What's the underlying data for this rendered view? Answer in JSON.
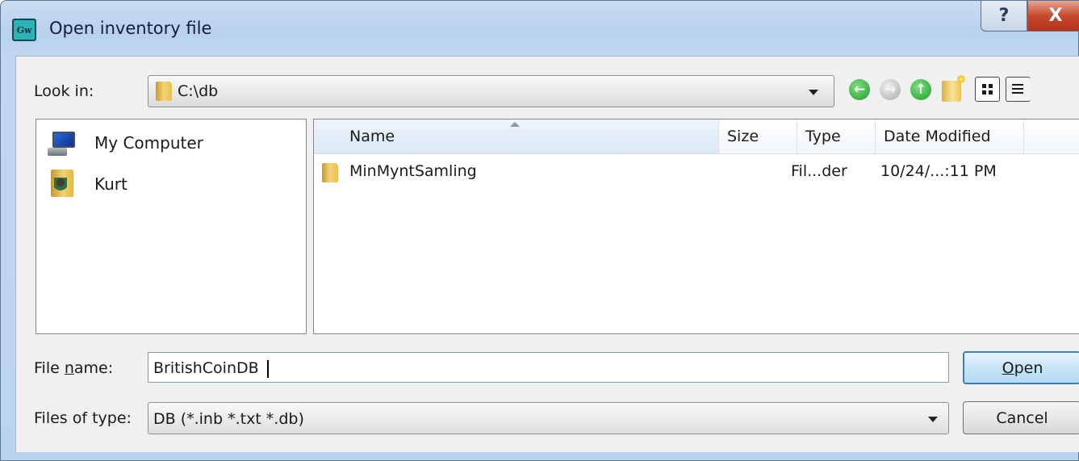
{
  "window": {
    "title": "Open inventory file",
    "app_icon_text": "Gw",
    "help_glyph": "?",
    "close_glyph": "X"
  },
  "look_in": {
    "label": "Look in:",
    "value": "C:\\db"
  },
  "toolbar": {
    "icons": [
      "back-icon",
      "forward-icon",
      "up-one-level-icon",
      "new-folder-icon",
      "view-list-icon",
      "view-details-icon"
    ]
  },
  "places": [
    {
      "label": "My Computer",
      "icon": "computer-icon"
    },
    {
      "label": "Kurt",
      "icon": "user-folder-icon"
    }
  ],
  "file_list": {
    "columns": [
      "Name",
      "Size",
      "Type",
      "Date Modified"
    ],
    "sorted_by": "Name",
    "rows": [
      {
        "name": "MinMyntSamling",
        "size": "",
        "type": "Fil...der",
        "date": "10/24/...:11 PM"
      }
    ]
  },
  "file_name": {
    "label_prefix": "File ",
    "label_underlined": "n",
    "label_suffix": "ame:",
    "value": "BritishCoinDB "
  },
  "file_type": {
    "label": "Files of type:",
    "value": "DB (*.inb *.txt *.db)"
  },
  "buttons": {
    "open_underlined": "O",
    "open_rest": "pen",
    "cancel": "Cancel"
  }
}
